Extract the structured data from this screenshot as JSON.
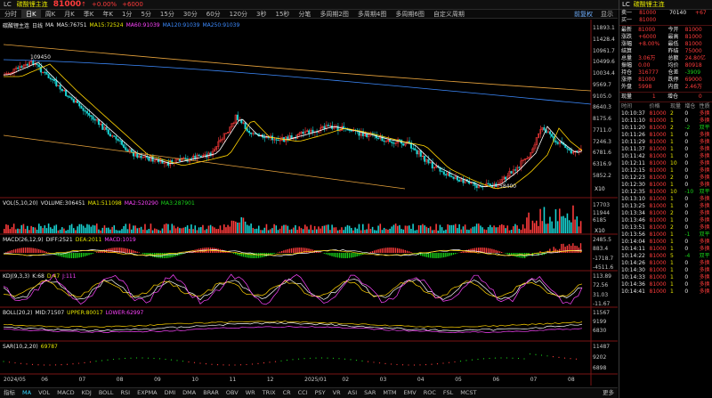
{
  "title": {
    "code": "LC",
    "name": "碳酸锂主连",
    "price": "81000",
    "arrow": "↑",
    "change_pct": "+0.00%",
    "change": "+6000"
  },
  "toolbar": {
    "periods": [
      "分时",
      "日K",
      "周K",
      "月K",
      "季K",
      "年K",
      "1分",
      "5分",
      "15分",
      "30分",
      "60分",
      "120分",
      "3秒",
      "15秒",
      "分笔",
      "多周期2图",
      "多周期4图",
      "多周期6图",
      "自定义周期"
    ],
    "active_index": 1,
    "dropdown1": "前复权",
    "dropdown2": "显示"
  },
  "main_legend": {
    "name": "碳酸锂主连",
    "period": "日线",
    "ma": [
      "MA",
      "MA5:76751",
      "MA15:72524",
      "MA60:91039",
      "MA120:91039",
      "MA250:91039"
    ]
  },
  "main_axis": [
    "11893.1",
    "11428.4",
    "10961.7",
    "10499.6",
    "10034.4",
    "9569.7",
    "9105.0",
    "8640.3",
    "8175.6",
    "7711.0",
    "7246.3",
    "6781.6",
    "6316.9",
    "5852.2"
  ],
  "annotations": {
    "high": "109450",
    "low": "58400",
    "x10": "X10"
  },
  "vol": {
    "legend": [
      "VOL(5,10,20)",
      "VOLUME:306451",
      "MA1:511098",
      "MA2:520290",
      "MA3:287901"
    ],
    "axis": [
      "17703",
      "11944",
      "6185"
    ]
  },
  "macd": {
    "legend": [
      "MACD(26,12,9)",
      "DIFF:2521",
      "DEA:2011",
      "MACD:1019"
    ],
    "axis": [
      "2485.5",
      "883.4",
      "-1718.7",
      "-4511.6"
    ]
  },
  "kdj": {
    "legend": [
      "KDJ(9,3,3)",
      "K:68",
      "D:47",
      "J:111"
    ],
    "axis": [
      "113.89",
      "72.56",
      "31.03",
      "-11.67"
    ]
  },
  "boll": {
    "legend": [
      "BOLL(20,2)",
      "MID:71507",
      "UPPER:80017",
      "LOWER:62997"
    ],
    "axis": [
      "11567",
      "9199",
      "6830"
    ]
  },
  "sar": {
    "legend": [
      "SAR(10,2,20)",
      "69787"
    ],
    "axis": [
      "11487",
      "9202",
      "6898"
    ]
  },
  "dates": [
    "2024/05",
    "06",
    "07",
    "08",
    "09",
    "10",
    "11",
    "12",
    "2025/01",
    "02",
    "03",
    "04",
    "05",
    "06",
    "07",
    "08"
  ],
  "indicator_tabs": [
    "指标",
    "MA",
    "VOL",
    "MACD",
    "KDJ",
    "BOLL",
    "RSI",
    "EXPMA",
    "DMI",
    "DMA",
    "BRAR",
    "OBV",
    "WR",
    "TRIX",
    "CR",
    "CCI",
    "PSY",
    "VR",
    "ASI",
    "SAR",
    "MTM",
    "EMV",
    "ROC",
    "FSL",
    "MCST"
  ],
  "indicator_active": 1,
  "indicator_extra": "更多",
  "right_panel": {
    "code": "LC",
    "name": "碳酸锂主连",
    "quote": [
      [
        "卖一",
        "81000",
        "",
        "70140",
        "+67"
      ],
      [
        "买一",
        "81000",
        "",
        "",
        ""
      ]
    ],
    "stats": [
      [
        "最新",
        "81000",
        "今开",
        "81000"
      ],
      [
        "涨跌",
        "+6000",
        "最高",
        "81000"
      ],
      [
        "涨幅",
        "+8.00%",
        "最低",
        "81000"
      ],
      [
        "结算",
        "",
        "昨结",
        "75000"
      ],
      [
        "总量",
        "3.06万",
        "总额",
        "24.80亿"
      ],
      [
        "振幅",
        "0.00",
        "均价",
        "80918"
      ],
      [
        "持仓",
        "316777",
        "仓差",
        "-3909"
      ],
      [
        "涨停",
        "81000",
        "跌停",
        "69000"
      ],
      [
        "外盘",
        "5998",
        "内盘",
        "2.46万"
      ]
    ],
    "ratio": [
      "现量",
      "1",
      "增仓",
      "0"
    ],
    "tick_header": [
      "时间",
      "价格",
      "现量",
      "增仓",
      "性质"
    ],
    "ticks": [
      [
        "10:10:37",
        "81000",
        "2",
        "0",
        "多换"
      ],
      [
        "10:11:10",
        "81000",
        "1",
        "0",
        "多换"
      ],
      [
        "10:11:20",
        "81000",
        "2",
        "-2",
        "双平"
      ],
      [
        "10:11:26",
        "81000",
        "1",
        "0",
        "多换"
      ],
      [
        "10:11:29",
        "81000",
        "1",
        "0",
        "多换"
      ],
      [
        "10:11:37",
        "81000",
        "1",
        "0",
        "多换"
      ],
      [
        "10:11:42",
        "81000",
        "1",
        "0",
        "多换"
      ],
      [
        "10:12:11",
        "81000",
        "10",
        "0",
        "多换"
      ],
      [
        "10:12:15",
        "81000",
        "1",
        "0",
        "多换"
      ],
      [
        "10:12:23",
        "81000",
        "2",
        "0",
        "多换"
      ],
      [
        "10:12:30",
        "81000",
        "1",
        "0",
        "多换"
      ],
      [
        "10:12:35",
        "81000",
        "10",
        "-10",
        "双平"
      ],
      [
        "10:13:10",
        "81000",
        "1",
        "0",
        "多换"
      ],
      [
        "10:13:25",
        "81000",
        "1",
        "0",
        "多换"
      ],
      [
        "10:13:34",
        "81000",
        "2",
        "0",
        "多换"
      ],
      [
        "10:13:46",
        "81000",
        "1",
        "0",
        "多换"
      ],
      [
        "10:13:51",
        "81000",
        "2",
        "0",
        "多换"
      ],
      [
        "10:13:56",
        "81000",
        "1",
        "-1",
        "双平"
      ],
      [
        "10:14:04",
        "81000",
        "1",
        "0",
        "多换"
      ],
      [
        "10:14:11",
        "81000",
        "1",
        "0",
        "多换"
      ],
      [
        "10:14:22",
        "81000",
        "5",
        "-4",
        "双平"
      ],
      [
        "10:14:26",
        "81000",
        "1",
        "0",
        "多换"
      ],
      [
        "10:14:30",
        "81000",
        "1",
        "0",
        "多换"
      ],
      [
        "10:14:33",
        "81000",
        "1",
        "0",
        "多换"
      ],
      [
        "10:14:36",
        "81000",
        "1",
        "0",
        "多换"
      ],
      [
        "10:14:41",
        "81000",
        "1",
        "0",
        "多换"
      ]
    ]
  }
}
